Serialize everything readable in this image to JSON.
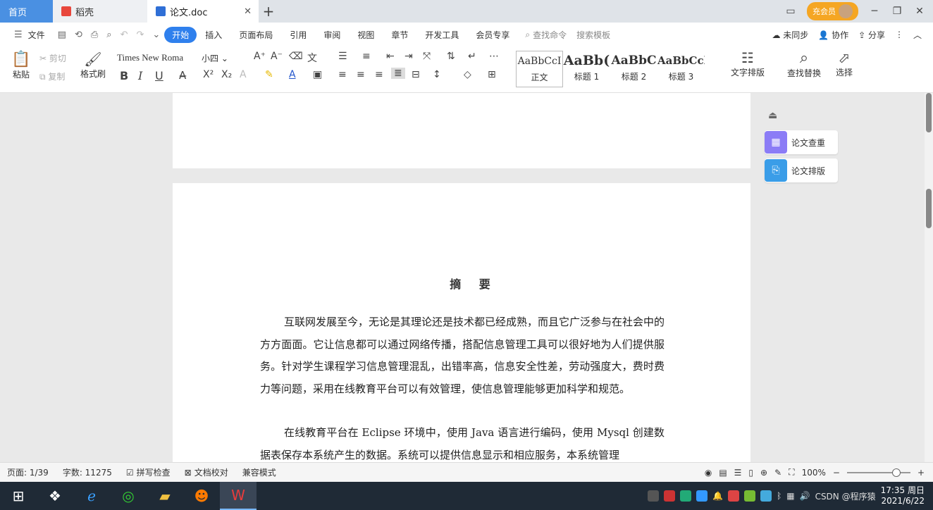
{
  "titlebar": {
    "tabs": [
      {
        "label": "首页"
      },
      {
        "label": "稻壳"
      },
      {
        "label": "论文.doc"
      }
    ],
    "new_tab": "+",
    "vip_label": "充会员",
    "colors": {
      "home_tab": "#4a90e2",
      "vip": "#f5a623"
    }
  },
  "menubar": {
    "file": "文件",
    "items": [
      "开始",
      "插入",
      "页面布局",
      "引用",
      "审阅",
      "视图",
      "章节",
      "开发工具",
      "会员专享"
    ],
    "search_cmd": "查找命令",
    "search_template": "搜索模板",
    "unsynced": "未同步",
    "collab": "协作",
    "share": "分享"
  },
  "ribbon": {
    "paste": "粘贴",
    "cut": "剪切",
    "copy": "复制",
    "format_painter": "格式刷",
    "font_name": "Times New Roma",
    "font_size": "小四",
    "styles": [
      {
        "preview": "AaBbCcI",
        "name": "正文"
      },
      {
        "preview": "AaBb(",
        "name": "标题 1"
      },
      {
        "preview": "AaBbC",
        "name": "标题 2"
      },
      {
        "preview": "AaBbCcl",
        "name": "标题 3"
      }
    ],
    "text_layout": "文字排版",
    "find_replace": "查找替换",
    "select": "选择"
  },
  "document": {
    "heading": "摘 要",
    "para1": "互联网发展至今，无论是其理论还是技术都已经成熟，而且它广泛参与在社会中的方方面面。它让信息都可以通过网络传播，搭配信息管理工具可以很好地为人们提供服务。针对学生课程学习信息管理混乱，出错率高，信息安全性差，劳动强度大，费时费力等问题，采用在线教育平台可以有效管理，使信息管理能够更加科学和规范。",
    "para2": "在线教育平台在 Eclipse 环境中，使用 Java 语言进行编码，使用 Mysql 创建数据表保存本系统产生的数据。系统可以提供信息显示和相应服务，本系统管理"
  },
  "right_panel": {
    "item1": "论文查重",
    "item2": "论文排版"
  },
  "statusbar": {
    "page": "页面: 1/39",
    "words": "字数: 11275",
    "spell": "拼写检查",
    "proof": "文档校对",
    "compat": "兼容模式",
    "zoom": "100%"
  },
  "taskbar": {
    "csdn": "CSDN @程序猿",
    "time": "17:35 周日",
    "date": "2021/6/22"
  }
}
